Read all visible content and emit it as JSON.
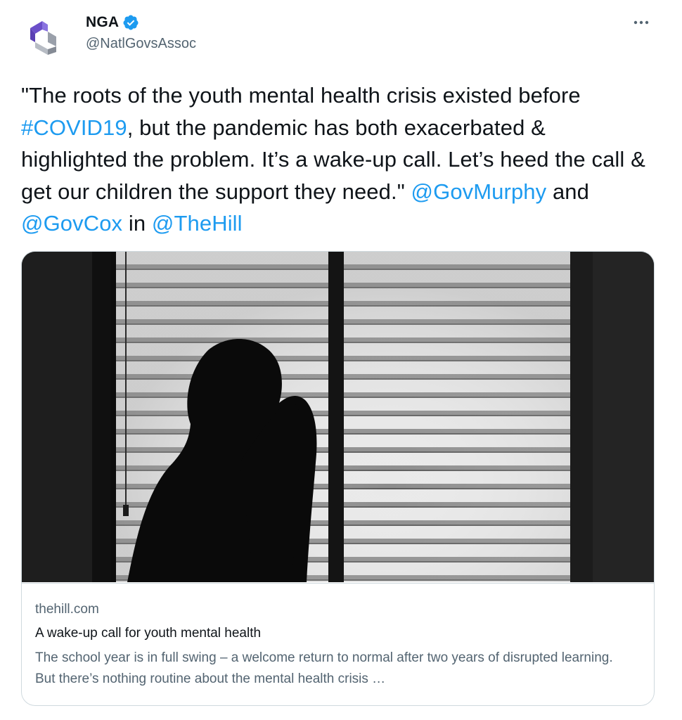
{
  "author": {
    "display_name": "NGA",
    "handle": "@NatlGovsAssoc",
    "verified_icon": "verified-badge-icon",
    "avatar_icon": "nga-logo-icon"
  },
  "more_menu": {
    "icon": "more-horizontal-icon"
  },
  "tweet": {
    "text_before_hashtag": "\"The roots of the youth mental health crisis existed before ",
    "hashtag": "#COVID19",
    "text_after_hashtag": ", but the pandemic has both exacerbated & highlighted the problem. It’s a wake-up call. Let’s heed the call & get our children the support they need.\" ",
    "mention_1": "@GovMurphy",
    "connector_and": " and ",
    "mention_2": "@GovCox",
    "connector_in": " in ",
    "mention_3": "@TheHill"
  },
  "card": {
    "domain": "thehill.com",
    "title": "A wake-up call for youth mental health",
    "description": "The school year is in full swing – a welcome return to normal after two years of disrupted learning. But there’s nothing routine about the mental health crisis …"
  },
  "colors": {
    "link": "#1d9bf0",
    "text": "#0f1419",
    "secondary": "#536471",
    "border": "#cfd9de",
    "logo_purple": "#6a5acd",
    "logo_gray": "#8a8f99"
  }
}
